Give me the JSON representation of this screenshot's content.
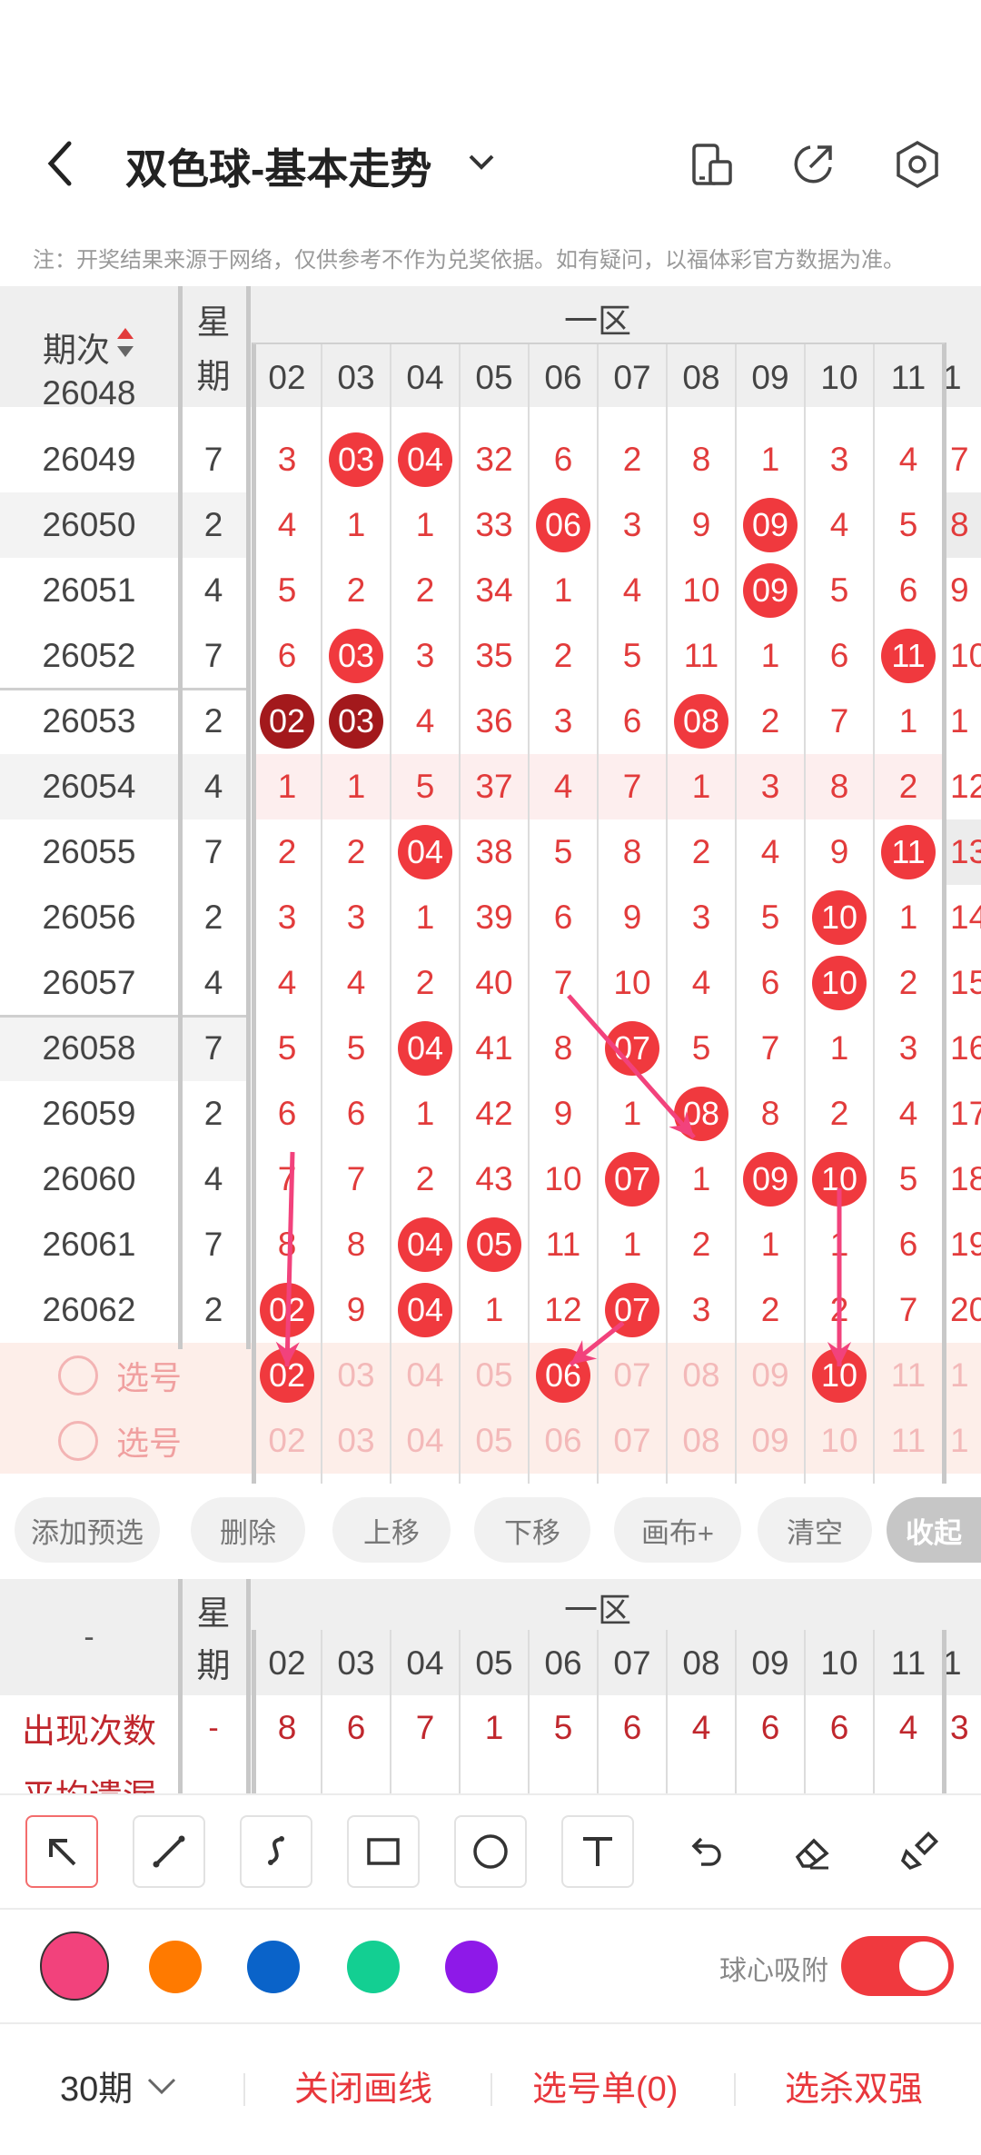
{
  "header": {
    "title": "双色球-基本走势",
    "icons": [
      "back-arrow-icon",
      "chevron-down-icon",
      "device-layout-icon",
      "share-icon",
      "settings-icon"
    ]
  },
  "note": "注：开奖结果来源于网络，仅供参考不作为兑奖依据。如有疑问，以福体彩官方数据为准。",
  "table": {
    "col_period": "期次",
    "col_week_1": "星",
    "col_week_2": "期",
    "zone_label": "一区",
    "numbers": [
      "02",
      "03",
      "04",
      "05",
      "06",
      "07",
      "08",
      "09",
      "10",
      "11"
    ],
    "partial_row": "26048",
    "rows": [
      {
        "period": "26049",
        "week": "7",
        "cells": [
          "3",
          "03",
          "04",
          "32",
          "6",
          "2",
          "8",
          "1",
          "3",
          "4"
        ],
        "hits": [
          1,
          2
        ],
        "overflow": "7"
      },
      {
        "period": "26050",
        "week": "2",
        "cells": [
          "4",
          "1",
          "1",
          "33",
          "06",
          "3",
          "9",
          "09",
          "4",
          "5"
        ],
        "hits": [
          4,
          7
        ],
        "overflow": "8"
      },
      {
        "period": "26051",
        "week": "4",
        "cells": [
          "5",
          "2",
          "2",
          "34",
          "1",
          "4",
          "10",
          "09",
          "5",
          "6"
        ],
        "hits": [
          7
        ],
        "overflow": "9"
      },
      {
        "period": "26052",
        "week": "7",
        "cells": [
          "6",
          "03",
          "3",
          "35",
          "2",
          "5",
          "11",
          "1",
          "6",
          "11"
        ],
        "hits": [
          1,
          9
        ],
        "overflow": "10"
      },
      {
        "period": "26053",
        "week": "2",
        "cells": [
          "02",
          "03",
          "4",
          "36",
          "3",
          "6",
          "08",
          "2",
          "7",
          "1"
        ],
        "hits": [
          0,
          1,
          6
        ],
        "dark": [
          0,
          1
        ],
        "overflow": "1"
      },
      {
        "period": "26054",
        "week": "4",
        "cells": [
          "1",
          "1",
          "5",
          "37",
          "4",
          "7",
          "1",
          "3",
          "8",
          "2"
        ],
        "hits": [],
        "overflow": "12"
      },
      {
        "period": "26055",
        "week": "7",
        "cells": [
          "2",
          "2",
          "04",
          "38",
          "5",
          "8",
          "2",
          "4",
          "9",
          "11"
        ],
        "hits": [
          2,
          9
        ],
        "overflow": "13"
      },
      {
        "period": "26056",
        "week": "2",
        "cells": [
          "3",
          "3",
          "1",
          "39",
          "6",
          "9",
          "3",
          "5",
          "10",
          "1"
        ],
        "hits": [
          8
        ],
        "overflow": "14"
      },
      {
        "period": "26057",
        "week": "4",
        "cells": [
          "4",
          "4",
          "2",
          "40",
          "7",
          "10",
          "4",
          "6",
          "10",
          "2"
        ],
        "hits": [
          8
        ],
        "overflow": "15"
      },
      {
        "period": "26058",
        "week": "7",
        "cells": [
          "5",
          "5",
          "04",
          "41",
          "8",
          "07",
          "5",
          "7",
          "1",
          "3"
        ],
        "hits": [
          2,
          5
        ],
        "overflow": "16"
      },
      {
        "period": "26059",
        "week": "2",
        "cells": [
          "6",
          "6",
          "1",
          "42",
          "9",
          "1",
          "08",
          "8",
          "2",
          "4"
        ],
        "hits": [
          6
        ],
        "overflow": "17"
      },
      {
        "period": "26060",
        "week": "4",
        "cells": [
          "7",
          "7",
          "2",
          "43",
          "10",
          "07",
          "1",
          "09",
          "10",
          "5"
        ],
        "hits": [
          5,
          7,
          8
        ],
        "overflow": "18"
      },
      {
        "period": "26061",
        "week": "7",
        "cells": [
          "8",
          "8",
          "04",
          "05",
          "11",
          "1",
          "2",
          "1",
          "1",
          "6"
        ],
        "hits": [
          2,
          3
        ],
        "overflow": "19"
      },
      {
        "period": "26062",
        "week": "2",
        "cells": [
          "02",
          "9",
          "04",
          "1",
          "12",
          "07",
          "3",
          "2",
          "2",
          "7"
        ],
        "hits": [
          0,
          2,
          5
        ],
        "overflow": "20"
      }
    ],
    "select_label": "选号",
    "select_rows": [
      {
        "selected": [
          0,
          4,
          8
        ]
      },
      {
        "selected": []
      }
    ]
  },
  "actions": [
    "添加预选",
    "删除",
    "上移",
    "下移",
    "画布+",
    "清空",
    "收起"
  ],
  "stats": {
    "corner": "-",
    "week_1": "星",
    "week_2": "期",
    "zone_label": "一区",
    "row_label": "出现次数",
    "row_week": "-",
    "row_values": [
      "8",
      "6",
      "7",
      "1",
      "5",
      "6",
      "4",
      "6",
      "6",
      "4"
    ],
    "row_overflow": "3",
    "row2_label": "平均遗漏"
  },
  "tools": [
    "arrow-tool-icon",
    "line-tool-icon",
    "curve-tool-icon",
    "rectangle-tool-icon",
    "circle-tool-icon",
    "text-tool-icon",
    "undo-icon",
    "eraser-icon",
    "brush-icon"
  ],
  "colors": [
    "#f2427c",
    "#ff7a00",
    "#0a63c9",
    "#13cf92",
    "#8e19e8"
  ],
  "snap_label": "球心吸附",
  "snap_on": true,
  "bottom": {
    "periods": "30期",
    "close_lines": "关闭画线",
    "selection": "选号单(0)",
    "pick_strong": "选杀双强"
  },
  "accent": "#f0393e"
}
